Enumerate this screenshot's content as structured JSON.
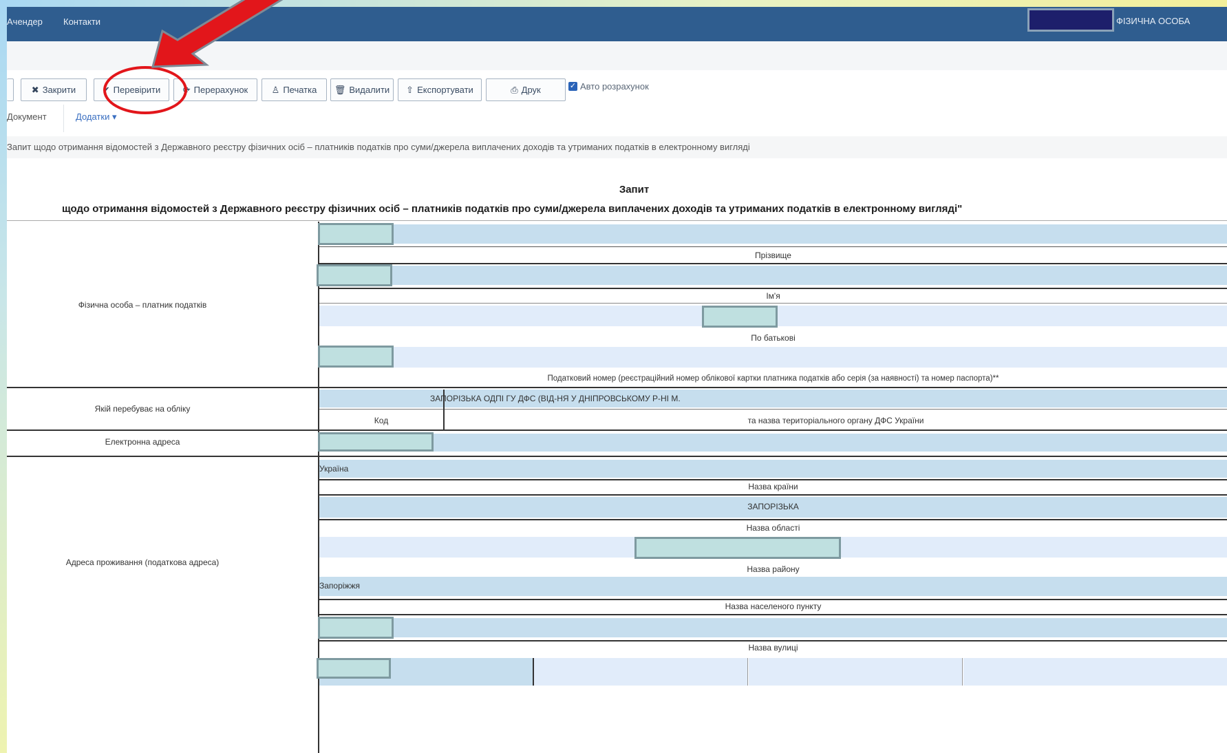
{
  "navbar": {
    "link1": "Ачендер",
    "link2": "Контакти",
    "user_label": "ФІЗИЧНА ОСОБА"
  },
  "toolbar": {
    "close": "Закрити",
    "check": "Перевірити",
    "recalc": "Перерахунок",
    "print": "Печатка",
    "delete": "Видалити",
    "export": "Експортувати",
    "print2": "Друк",
    "auto_calc": "Авто розрахунок"
  },
  "tabs": {
    "tab1": "Документ",
    "tab2": "Додатки"
  },
  "doc_line": "Запит щодо отримання відомостей з Державного реєстру фізичних осіб – платників податків про суми/джерела виплачених доходів та утриманих податків в електронному вигляді",
  "title": {
    "line1": "Запит",
    "line2": "щодо отримання відомостей з Державного реєстру фізичних осіб – платників податків про суми/джерела виплачених доходів та утриманих податків в електронному вигляді\""
  },
  "form": {
    "section_person": "Фізична особа – платник податків",
    "caption_surname": "Прізвище",
    "caption_name": "Ім'я",
    "caption_patronymic": "По батькові",
    "caption_tax_number": "Податковий номер (реєстраційний номер облікової картки платника податків або серія (за наявності) та номер паспорта)**",
    "section_office": "Якій перебуває на обліку",
    "office_value": "ЗАПОРІЗЬКА ОДПІ ГУ ДФС (ВІД-НЯ У ДНІПРОВСЬКОМУ Р-НІ М.",
    "caption_code": "Код",
    "caption_office_name": "та назва територіального органу ДФС України",
    "section_email": "Електронна адреса",
    "section_address": "Адреса проживання (податкова адреса)",
    "country_value": "Україна",
    "caption_country": "Назва країни",
    "region_value": "ЗАПОРІЗЬКА",
    "caption_region": "Назва області",
    "caption_district": "Назва району",
    "city_value": "Запоріжжя",
    "caption_city": "Назва населеного пункту",
    "caption_street": "Назва вулиці"
  },
  "colors": {
    "navbar": "#2f5d8f",
    "annotation": "#e2161b",
    "field_fill": "#c6deee"
  }
}
